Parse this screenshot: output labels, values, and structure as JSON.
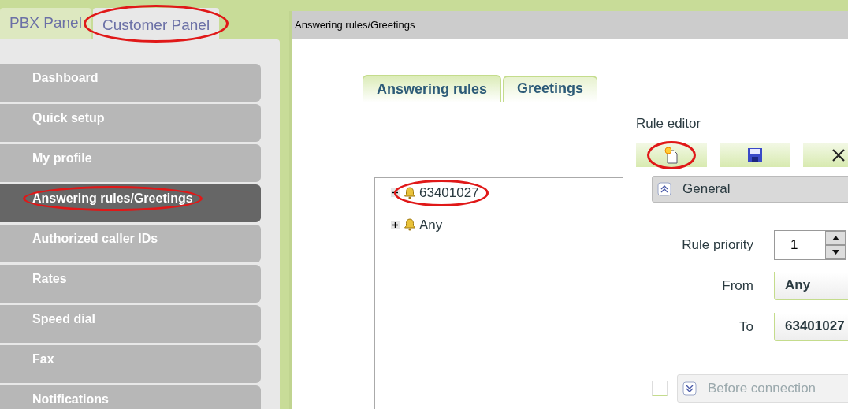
{
  "top_tabs": [
    {
      "label": "PBX Panel",
      "selected": false,
      "circled": false
    },
    {
      "label": "Customer Panel",
      "selected": true,
      "circled": true
    }
  ],
  "sidebar": {
    "items": [
      {
        "label": "Dashboard",
        "selected": false,
        "circled": false
      },
      {
        "label": "Quick setup",
        "selected": false,
        "circled": false
      },
      {
        "label": "My profile",
        "selected": false,
        "circled": false
      },
      {
        "label": "Answering rules/Greetings",
        "selected": true,
        "circled": true
      },
      {
        "label": "Authorized caller IDs",
        "selected": false,
        "circled": false
      },
      {
        "label": "Rates",
        "selected": false,
        "circled": false
      },
      {
        "label": "Speed dial",
        "selected": false,
        "circled": false
      },
      {
        "label": "Fax",
        "selected": false,
        "circled": false
      },
      {
        "label": "Notifications",
        "selected": false,
        "circled": false
      }
    ]
  },
  "window": {
    "title": "Answering rules/Greetings"
  },
  "tabs": [
    {
      "label": "Answering rules",
      "selected": true
    },
    {
      "label": "Greetings",
      "selected": false
    }
  ],
  "tree": [
    {
      "label": "63401027",
      "expanded": true,
      "circled": true
    },
    {
      "label": "Any",
      "expanded": false,
      "circled": false
    }
  ],
  "editor": {
    "title": "Rule editor",
    "toolbar": [
      {
        "kind": "new",
        "circled": true
      },
      {
        "kind": "save",
        "circled": false
      },
      {
        "kind": "close",
        "circled": false
      }
    ],
    "general_section": {
      "label": "General",
      "expanded": true
    },
    "fields": [
      {
        "kind": "spinner",
        "label": "Rule priority",
        "value": "1"
      },
      {
        "kind": "select",
        "label": "From",
        "value": "Any"
      },
      {
        "kind": "select",
        "label": "To",
        "value": "63401027"
      }
    ],
    "before_connection": {
      "label": "Before connection",
      "checked": false,
      "expanded": false
    }
  }
}
